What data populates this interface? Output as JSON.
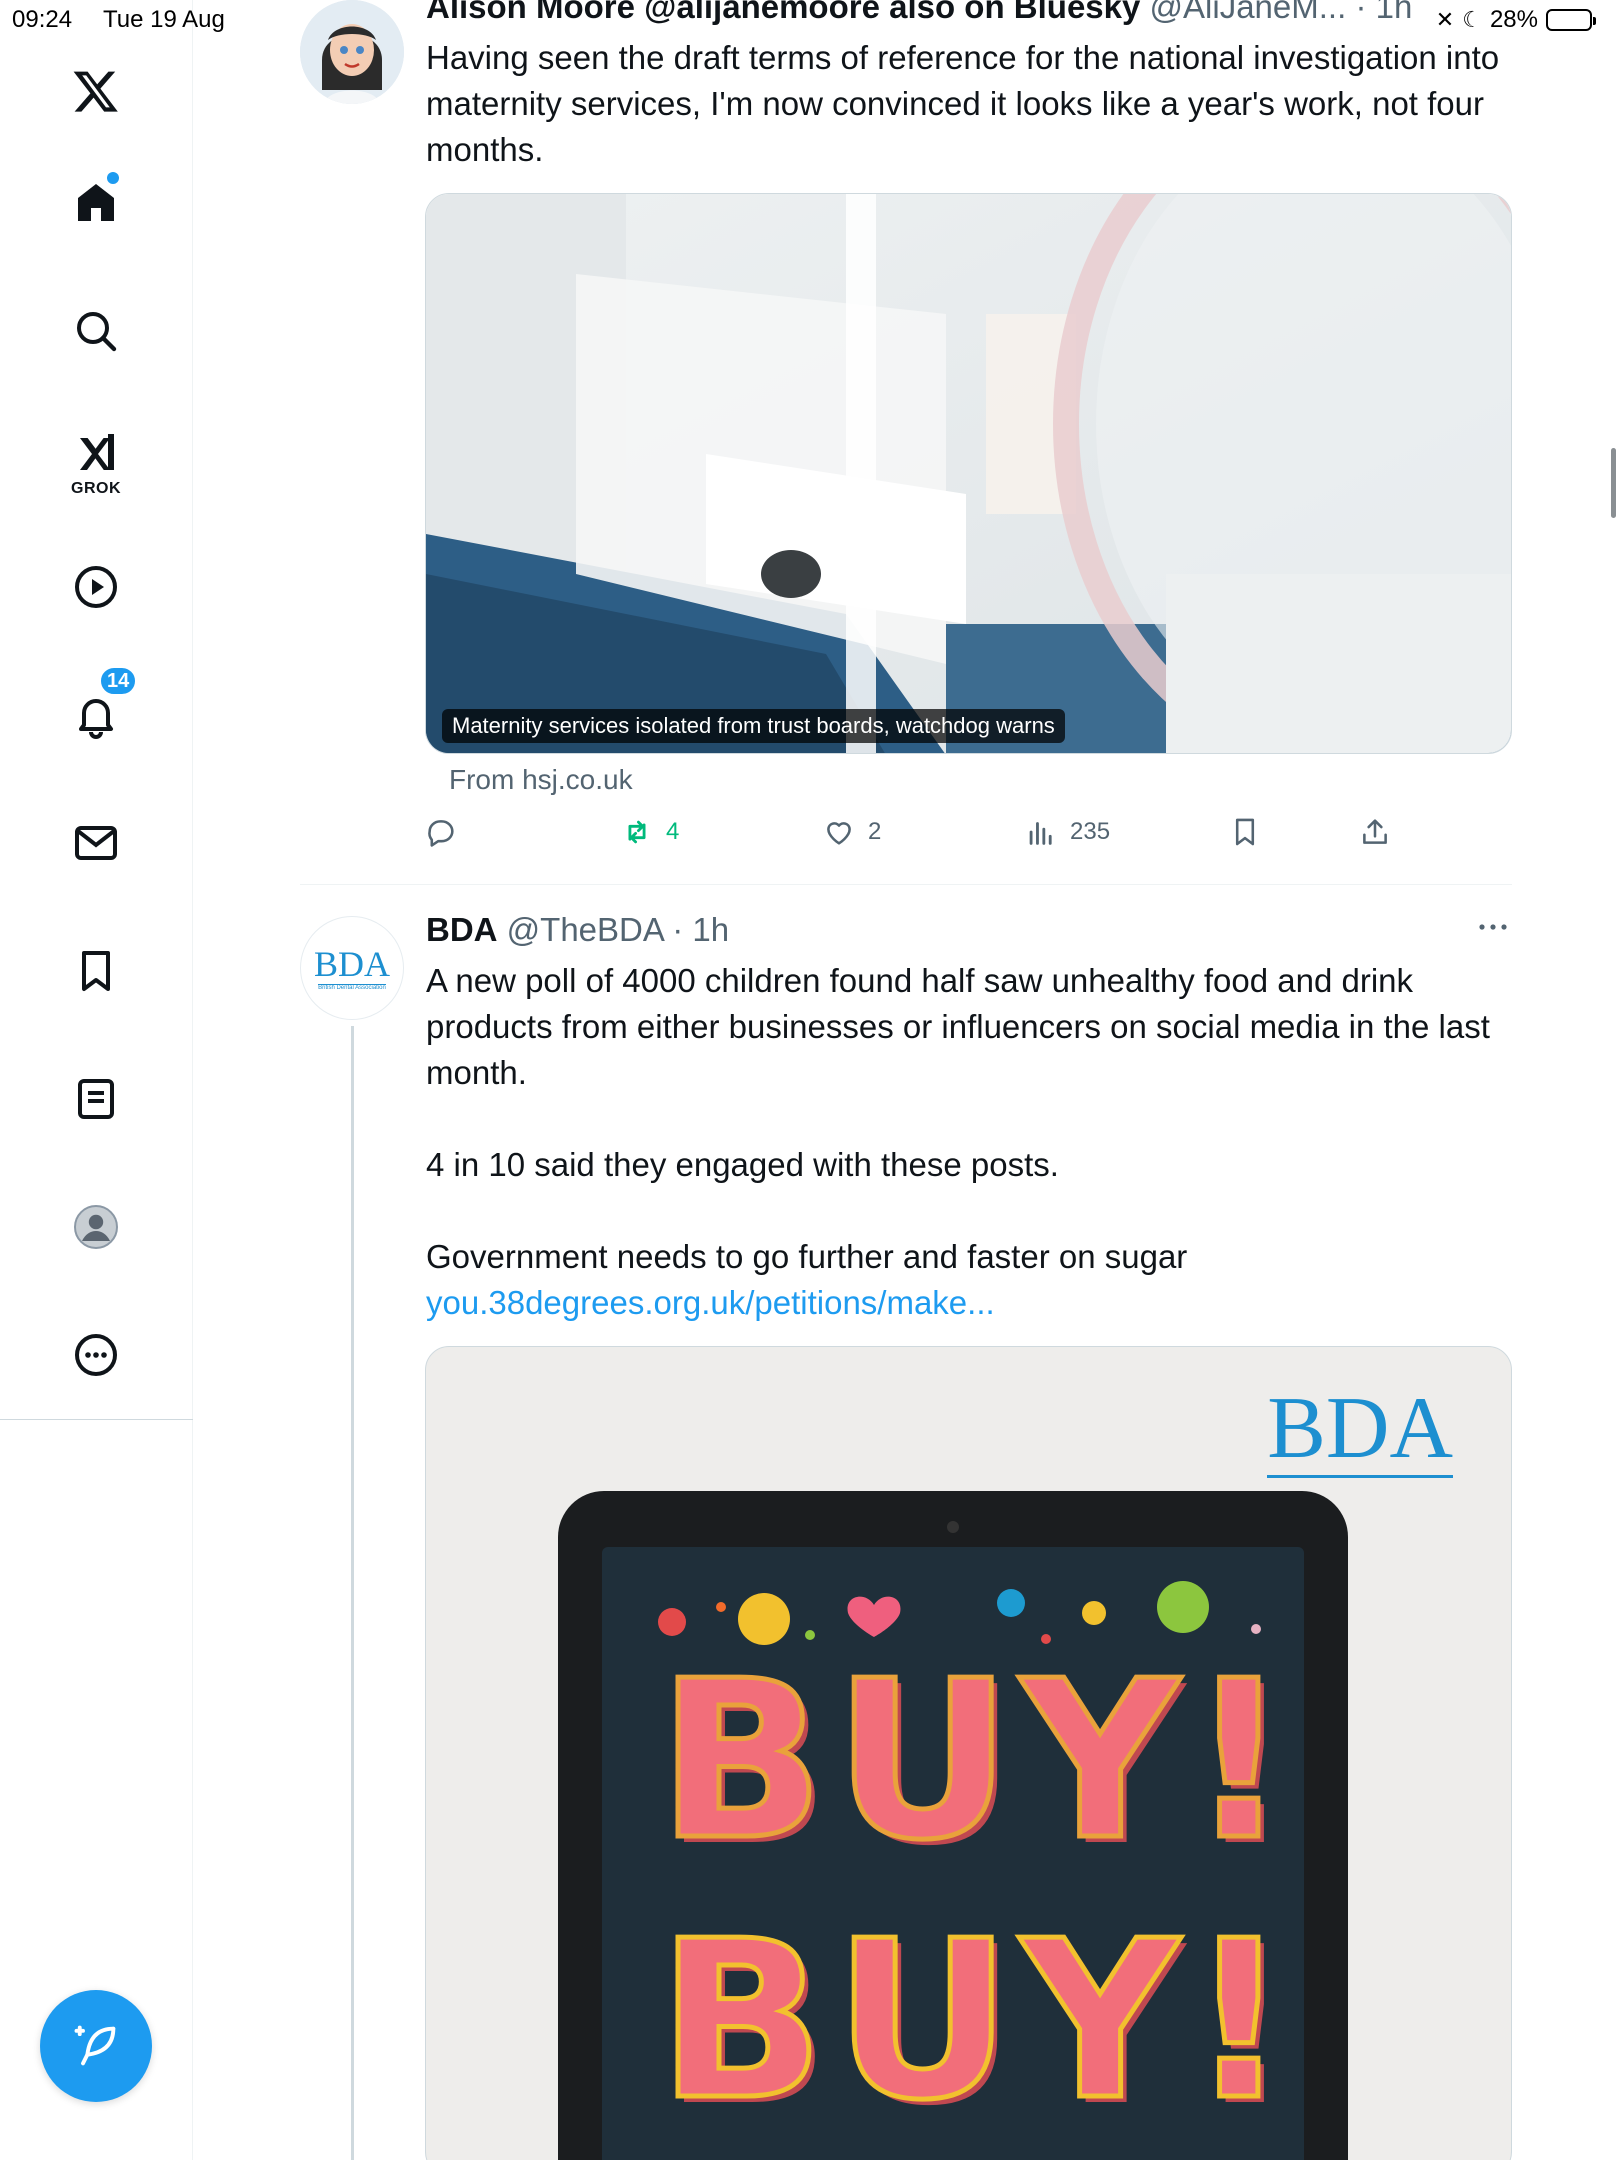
{
  "status_bar": {
    "time": "09:24",
    "date": "Tue 19 Aug",
    "battery": "28%"
  },
  "sidebar": {
    "items": [
      {
        "name": "x-logo",
        "label": "X"
      },
      {
        "name": "home",
        "label": "Home"
      },
      {
        "name": "search",
        "label": "Search"
      },
      {
        "name": "grok",
        "label": "GROK"
      },
      {
        "name": "videos",
        "label": "Videos"
      },
      {
        "name": "notifications",
        "label": "Notifications",
        "badge": "14"
      },
      {
        "name": "messages",
        "label": "Messages"
      },
      {
        "name": "bookmarks",
        "label": "Bookmarks"
      },
      {
        "name": "lists",
        "label": "Lists"
      },
      {
        "name": "profile",
        "label": "Profile"
      },
      {
        "name": "more",
        "label": "More"
      }
    ],
    "accent": "#1d9bf0"
  },
  "feed": {
    "tweets": [
      {
        "display_name": "Alison Moore @alijanemoore also on Bluesky",
        "handle": "@AliJaneM...",
        "time": "· 1h",
        "text": "Having seen the draft terms of reference for the national investigation into maternity services, I'm now convinced it looks like a year's work, not four months.",
        "card": {
          "caption": "Maternity services isolated from trust boards, watchdog warns",
          "source": "From hsj.co.uk"
        },
        "actions": {
          "replies": "",
          "retweets": "4",
          "likes": "2",
          "views": "235"
        }
      },
      {
        "display_name": "BDA",
        "handle": "@TheBDA",
        "time": "· 1h",
        "text_lines": [
          "A new poll of 4000 children found half saw unhealthy food and drink products from either businesses or influencers on social media in the last month.",
          "4 in 10 said they engaged with these posts.",
          "Government needs to go further and faster on sugar"
        ],
        "link": "you.38degrees.org.uk/petitions/make...",
        "avatar_text": "BDA",
        "avatar_subtext": "British Dental Association",
        "image": {
          "logo": "BDA",
          "headline_top": "BUY!",
          "headline_bottom": "BUY!"
        }
      }
    ]
  }
}
